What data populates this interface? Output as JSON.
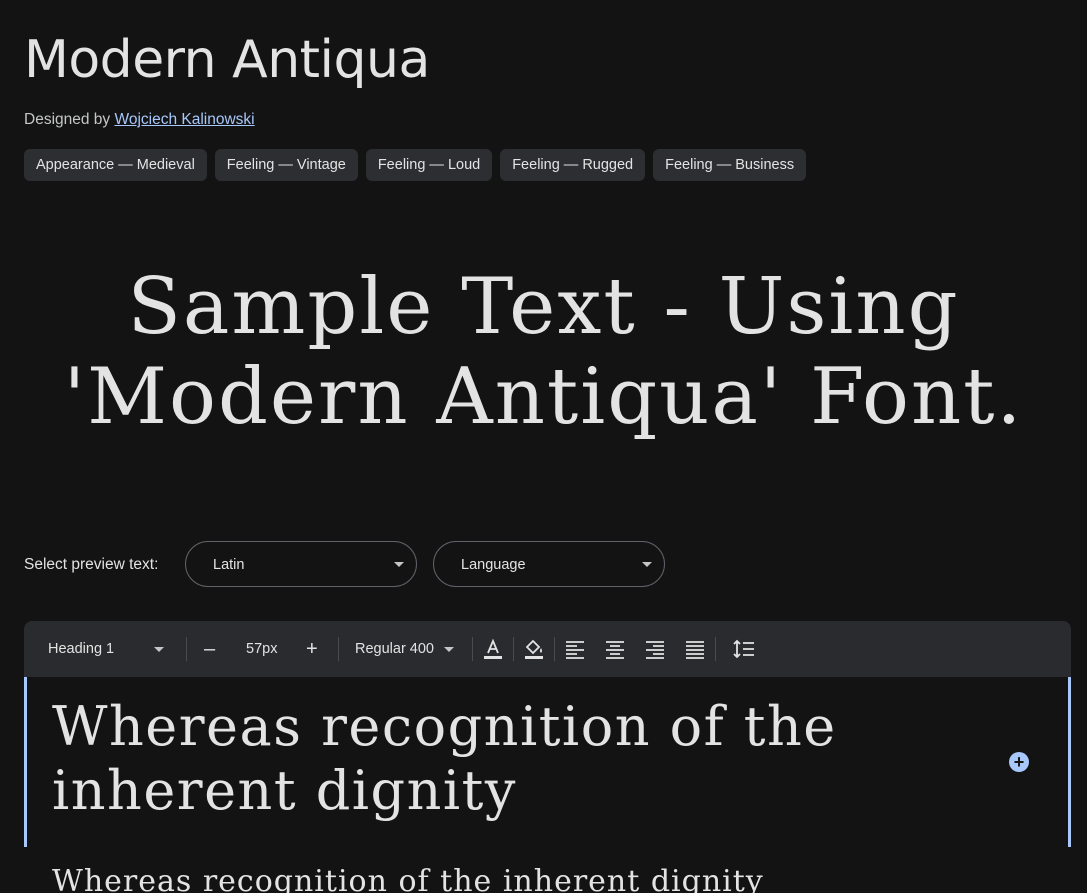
{
  "font": {
    "title": "Modern Antiqua",
    "designed_by_label": "Designed by",
    "designer": "Wojciech Kalinowski",
    "tags": [
      "Appearance — Medieval",
      "Feeling — Vintage",
      "Feeling — Loud",
      "Feeling — Rugged",
      "Feeling — Business"
    ]
  },
  "hero": {
    "line1": "Sample Text - Using",
    "line2": "'Modern Antiqua' Font."
  },
  "preview": {
    "label": "Select preview text:",
    "script_value": "Latin",
    "language_value": "Language"
  },
  "toolbar": {
    "style": "Heading 1",
    "decrease": "–",
    "size": "57px",
    "increase": "+",
    "weight": "Regular 400"
  },
  "editor": {
    "text": "Whereas recognition of the inherent dignity",
    "next_text": "Whereas recognition of the inherent dignity"
  },
  "colors": {
    "background": "#131314",
    "accent": "#a8c7fa",
    "chip": "#2d2e31"
  }
}
